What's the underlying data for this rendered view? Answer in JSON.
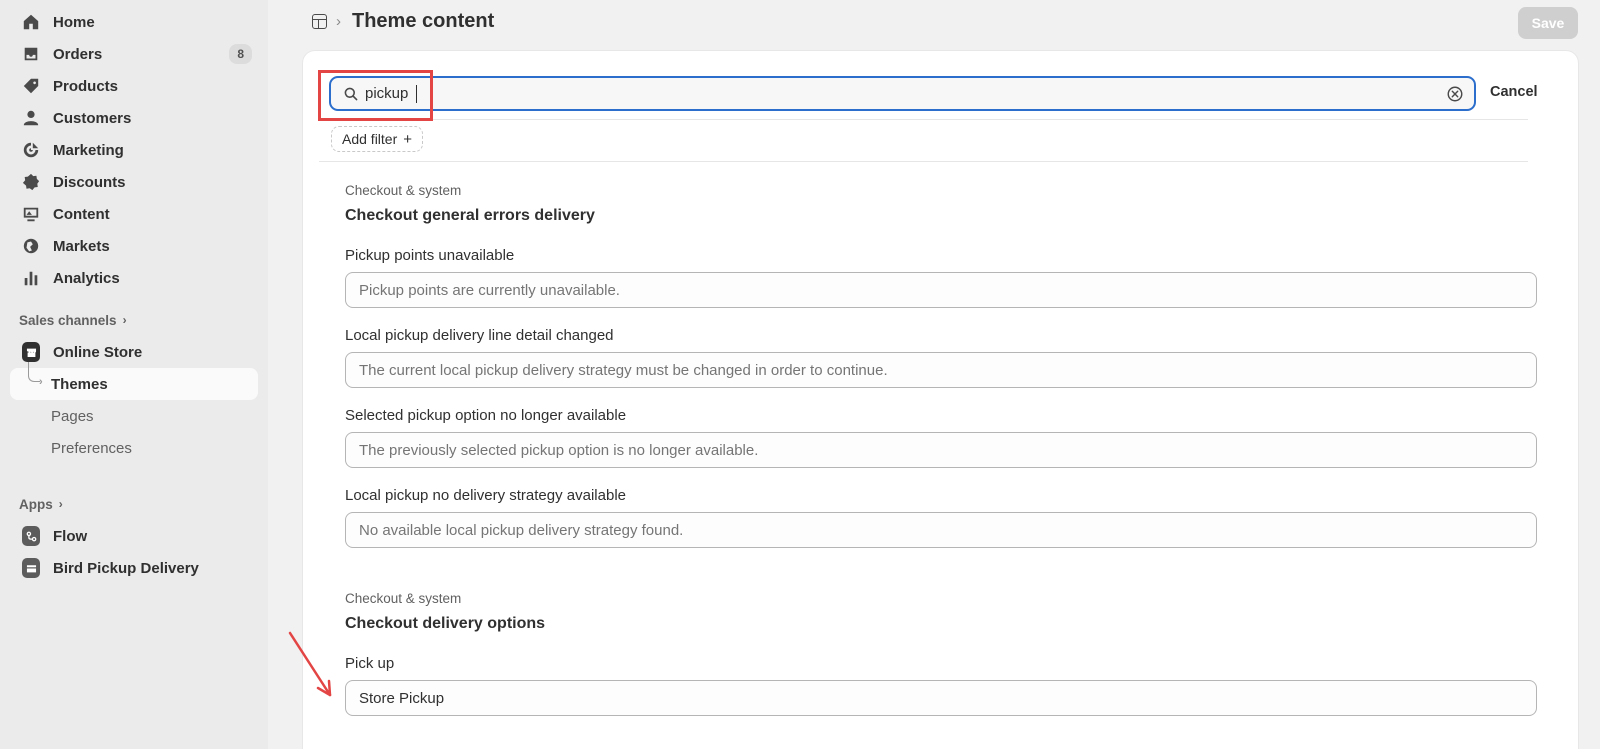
{
  "sidebar": {
    "items": [
      {
        "label": "Home"
      },
      {
        "label": "Orders",
        "badge": "8"
      },
      {
        "label": "Products"
      },
      {
        "label": "Customers"
      },
      {
        "label": "Marketing"
      },
      {
        "label": "Discounts"
      },
      {
        "label": "Content"
      },
      {
        "label": "Markets"
      },
      {
        "label": "Analytics"
      }
    ],
    "sales_channels_label": "Sales channels",
    "online_store": {
      "label": "Online Store",
      "sub": [
        {
          "label": "Themes"
        },
        {
          "label": "Pages"
        },
        {
          "label": "Preferences"
        }
      ]
    },
    "apps_label": "Apps",
    "apps": [
      {
        "label": "Flow"
      },
      {
        "label": "Bird Pickup Delivery"
      }
    ]
  },
  "header": {
    "title": "Theme content",
    "save_label": "Save"
  },
  "search": {
    "value": "pickup",
    "cancel_label": "Cancel",
    "add_filter_label": "Add filter",
    "add_filter_plus": "+"
  },
  "groups": [
    {
      "category": "Checkout & system",
      "title": "Checkout general errors delivery",
      "fields": [
        {
          "label": "Pickup points unavailable",
          "placeholder": "Pickup points are currently unavailable."
        },
        {
          "label": "Local pickup delivery line detail changed",
          "placeholder": "The current local pickup delivery strategy must be changed in order to continue."
        },
        {
          "label": "Selected pickup option no longer available",
          "placeholder": "The previously selected pickup option is no longer available."
        },
        {
          "label": "Local pickup no delivery strategy available",
          "placeholder": "No available local pickup delivery strategy found."
        }
      ]
    },
    {
      "category": "Checkout & system",
      "title": "Checkout delivery options",
      "fields": [
        {
          "label": "Pick up",
          "value": "Store Pickup"
        }
      ]
    }
  ],
  "colors": {
    "accent_focus": "#2c6ecb",
    "annotation": "#e34545"
  }
}
